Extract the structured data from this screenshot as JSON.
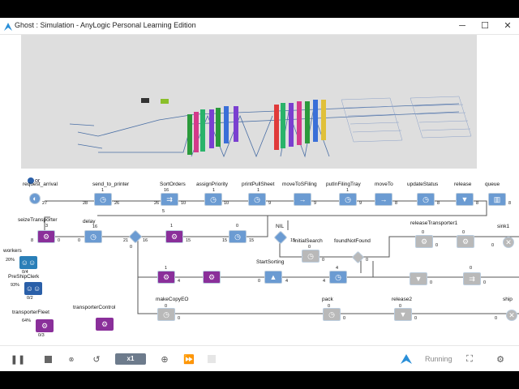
{
  "window": {
    "title": "Ghost : Simulation - AnyLogic Personal Learning Edition"
  },
  "viewport": {
    "left_label": "or"
  },
  "blocks": [
    {
      "id": "request_arrival",
      "label": "request_arrival",
      "count": "27",
      "glyph": "◐"
    },
    {
      "id": "send_to_printer",
      "label": "send_to_printer",
      "count": "1",
      "out": "26",
      "glyph": "◷"
    },
    {
      "id": "SortOrders",
      "label": "SortOrders",
      "count": "16",
      "out": "10",
      "glyph": "⇉"
    },
    {
      "id": "assignPriority",
      "label": "assignPriority",
      "count": "1",
      "out": "10",
      "glyph": "◷"
    },
    {
      "id": "printPullSheet",
      "label": "printPullSheet",
      "count": "1",
      "out": "9",
      "glyph": "◷"
    },
    {
      "id": "moveToSFiling",
      "label": "moveToSFiling",
      "count": "",
      "out": "9",
      "glyph": "→"
    },
    {
      "id": "putInFilingTray",
      "label": "putInFilingTray",
      "count": "1",
      "out": "9",
      "glyph": "◷"
    },
    {
      "id": "moveTo",
      "label": "moveTo",
      "count": "",
      "out": "8",
      "glyph": "→"
    },
    {
      "id": "updateStatus",
      "label": "updateStatus",
      "count": "",
      "out": "8",
      "glyph": "◷"
    },
    {
      "id": "release",
      "label": "release",
      "count": "",
      "out": "8",
      "glyph": "▼"
    },
    {
      "id": "queue",
      "label": "queue",
      "count": "",
      "out": "8",
      "glyph": "▥"
    },
    {
      "id": "seizeTransporter",
      "label": "seizeTransporter",
      "count": "3",
      "out": "0",
      "glyph": "⚙"
    },
    {
      "id": "delay",
      "label": "delay",
      "count": "",
      "out": "21",
      "glyph": "◷"
    },
    {
      "id": "NIL",
      "label": "NIL",
      "count": "",
      "out": "15",
      "glyph": "◆"
    },
    {
      "id": "InitialSearch",
      "label": "InitialSearch",
      "count": "",
      "out": "0",
      "glyph": "◷"
    },
    {
      "id": "foundNotFound",
      "label": "foundNotFound",
      "count": "",
      "out": "0",
      "glyph": "◆"
    },
    {
      "id": "releaseTransporter1",
      "label": "releaseTransporter1",
      "count": "0",
      "out": "0",
      "glyph": "⚙"
    },
    {
      "id": "sink1",
      "label": "sink1",
      "count": "0",
      "out": "",
      "glyph": "✕"
    },
    {
      "id": "StartSorting",
      "label": "StartSorting",
      "count": "",
      "out": "4",
      "glyph": "▲"
    },
    {
      "id": "makeCopyEO",
      "label": "makeCopyEO",
      "count": "0",
      "out": "0",
      "glyph": "◷"
    },
    {
      "id": "pack",
      "label": "pack",
      "count": "0",
      "out": "0",
      "glyph": "◷"
    },
    {
      "id": "release2",
      "label": "release2",
      "count": "0",
      "out": "0",
      "glyph": "▼"
    },
    {
      "id": "ship",
      "label": "ship",
      "count": "0",
      "out": "",
      "glyph": "✕"
    },
    {
      "id": "transporterControl",
      "label": "transporterControl",
      "count": "",
      "out": "",
      "glyph": "⚙"
    }
  ],
  "resources": [
    {
      "id": "workers",
      "label": "workers",
      "pct": "20%",
      "count": "0/4",
      "pct_value": 20,
      "color": "#2a7fb8"
    },
    {
      "id": "PreShipClerk",
      "label": "PreShipClerk",
      "pct": "93%",
      "count": "0/2",
      "pct_value": 93,
      "color": "#2a5fa8"
    },
    {
      "id": "transporterFleet",
      "label": "transporterFleet",
      "pct": "64%",
      "count": "0/3",
      "pct_value": 64,
      "color": "#8a2f9a"
    }
  ],
  "extra_counts": [
    "28",
    "5",
    "16",
    "15",
    "0",
    "15",
    "15",
    "0",
    "0",
    "1",
    "4",
    "1",
    "0",
    "0",
    "0",
    "8",
    "0",
    "0"
  ],
  "toolbar": {
    "speed_label": "x1",
    "status_label": "Running"
  },
  "colors": {
    "block_blue": "#6b9bd2",
    "block_purple": "#8a2f9a",
    "block_grey": "#b9b9b9",
    "status_running": "#888888"
  }
}
